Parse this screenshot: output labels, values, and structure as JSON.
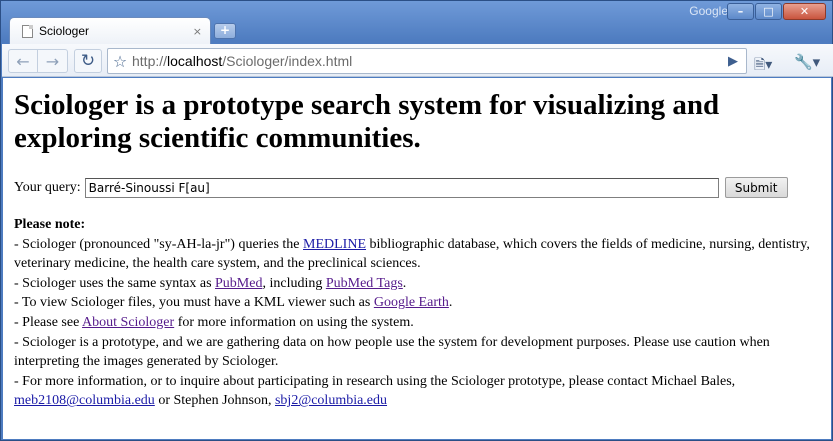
{
  "window": {
    "brand": "Google",
    "minimize_glyph": "–",
    "restore_glyph": "□",
    "close_glyph": "✕"
  },
  "tab": {
    "title": "Sciologer",
    "close_glyph": "×"
  },
  "toolbar": {
    "url_prefix": "http://",
    "url_host": "localhost",
    "url_path": "/Sciologer/index.html"
  },
  "page": {
    "heading": "Sciologer is a prototype search system for visualizing and exploring scientific communities.",
    "query_label": "Your query:",
    "query_value": "Barré-Sinoussi F[au]",
    "submit_label": "Submit",
    "note_title": "Please note",
    "note_colon": ":",
    "n1_a": "- Sciologer (pronounced \"sy-AH-la-jr\") queries the ",
    "n1_link": "MEDLINE",
    "n1_b": " bibliographic database, which covers the fields of medicine, nursing, dentistry, veterinary medicine, the health care system, and the preclinical sciences.",
    "n2_a": "- Sciologer uses the same syntax as ",
    "n2_link1": "PubMed",
    "n2_b": ", including ",
    "n2_link2": "PubMed Tags",
    "n2_c": ".",
    "n3_a": "- To view Sciologer files, you must have a KML viewer such as ",
    "n3_link": "Google Earth",
    "n3_b": ".",
    "n4_a": "- Please see ",
    "n4_link": "About Sciologer",
    "n4_b": " for more information on using the system.",
    "n5": "- Sciologer is a prototype, and we are gathering data on how people use the system for development purposes. Please use caution when interpreting the images generated by Sciologer.",
    "n6_a": "- For more information, or to inquire about participating in research using the Sciologer prototype, please contact Michael Bales, ",
    "n6_link1": "meb2108@columbia.edu",
    "n6_b": " or Stephen Johnson, ",
    "n6_link2": "sbj2@columbia.edu"
  }
}
